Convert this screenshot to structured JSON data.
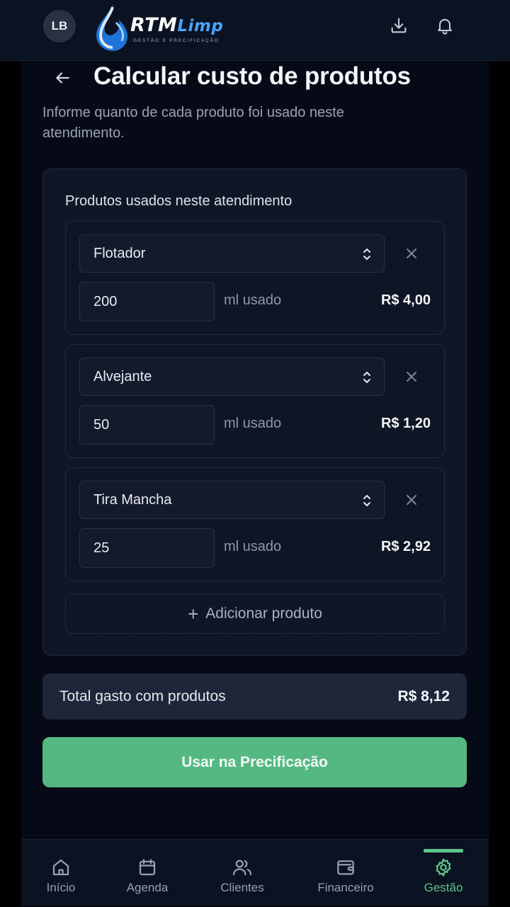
{
  "header": {
    "avatar_initials": "LB",
    "logo_main": "RTM",
    "logo_accent": "Limp",
    "logo_tagline": "GESTÃO E PRECIFICAÇÃO"
  },
  "page": {
    "title": "Calcular custo de produtos",
    "subtitle": "Informe quanto de cada produto foi usado neste atendimento."
  },
  "products_section": {
    "title": "Produtos usados neste atendimento",
    "unit_label": "ml usado",
    "items": [
      {
        "product": "Flotador",
        "quantity": "200",
        "cost": "R$ 4,00"
      },
      {
        "product": "Alvejante",
        "quantity": "50",
        "cost": "R$ 1,20"
      },
      {
        "product": "Tira Mancha",
        "quantity": "25",
        "cost": "R$ 2,92"
      }
    ],
    "add_label": "Adicionar produto"
  },
  "total": {
    "label": "Total gasto com produtos",
    "value": "R$ 8,12"
  },
  "cta_label": "Usar na Precificação",
  "nav": {
    "items": [
      {
        "label": "Início",
        "icon": "home-icon"
      },
      {
        "label": "Agenda",
        "icon": "calendar-icon"
      },
      {
        "label": "Clientes",
        "icon": "users-icon"
      },
      {
        "label": "Financeiro",
        "icon": "wallet-icon"
      },
      {
        "label": "Gestão",
        "icon": "gear-icon",
        "active": true
      }
    ]
  },
  "colors": {
    "accent": "#55b882",
    "background": "#050a16",
    "card": "#0f1626"
  }
}
